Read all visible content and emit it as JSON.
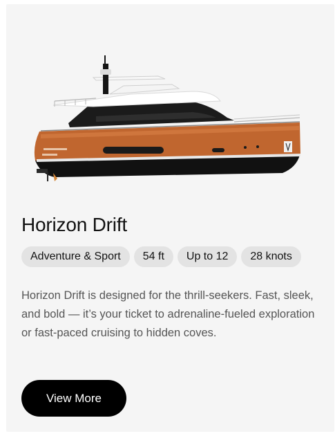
{
  "card": {
    "title": "Horizon Drift",
    "tags": [
      {
        "label": "Adventure & Sport"
      },
      {
        "label": "54 ft"
      },
      {
        "label": "Up to 12"
      },
      {
        "label": "28 knots"
      }
    ],
    "description": "Horizon Drift is designed for the thrill-seekers. Fast, sleek, and bold — it’s your ticket to adrenaline-fueled exploration or fast-paced cruising to hidden coves.",
    "cta_label": "View More"
  },
  "colors": {
    "hull": "#c0662f",
    "cta_background": "#000000",
    "tag_background": "#e3e3e3"
  }
}
